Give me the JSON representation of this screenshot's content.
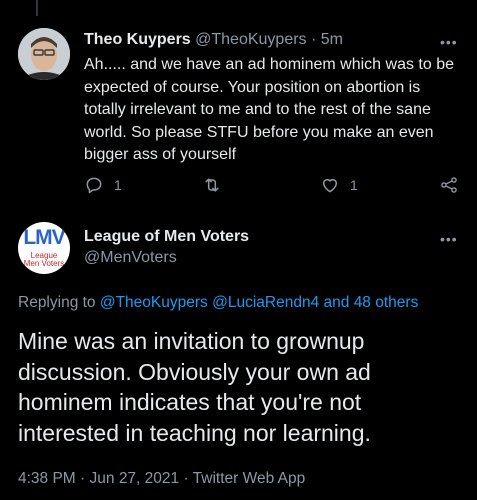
{
  "reply_tweet": {
    "author_name": "Theo Kuypers",
    "author_handle": "@TheoKuypers",
    "time_sep": " · ",
    "time": "5m",
    "more": "•••",
    "text": "Ah..... and we have an ad hominem which was to be expected of course. Your position on abortion is totally irrelevant to me and to the rest of the sane world. So please STFU before you make an even bigger ass of yourself",
    "reply_count": "1",
    "like_count": "1",
    "icons": [
      "reply-icon",
      "retweet-icon",
      "like-icon",
      "share-icon"
    ]
  },
  "main_tweet": {
    "author_name": "League of Men Voters",
    "author_handle": "@MenVoters",
    "more": "•••",
    "avatar_logo": "LMV",
    "avatar_sub1": "League",
    "avatar_sub2": "Men Voters",
    "replying_prefix": "Replying to ",
    "replying_handle1": "@TheoKuypers",
    "replying_handle2": "@LuciaRendn4",
    "replying_and": " and ",
    "replying_others": "48 others",
    "text": "Mine was an invitation to grownup discussion. Obviously your own ad hominem indicates that you're not interested in teaching nor learning.",
    "time": "4:38 PM",
    "date": "Jun 27, 2021",
    "source": "Twitter Web App",
    "sep": " · "
  },
  "colors": {
    "background": "#000000",
    "text": "#e7e9ea",
    "muted": "#8b98a5",
    "link": "#1d9bf0"
  }
}
